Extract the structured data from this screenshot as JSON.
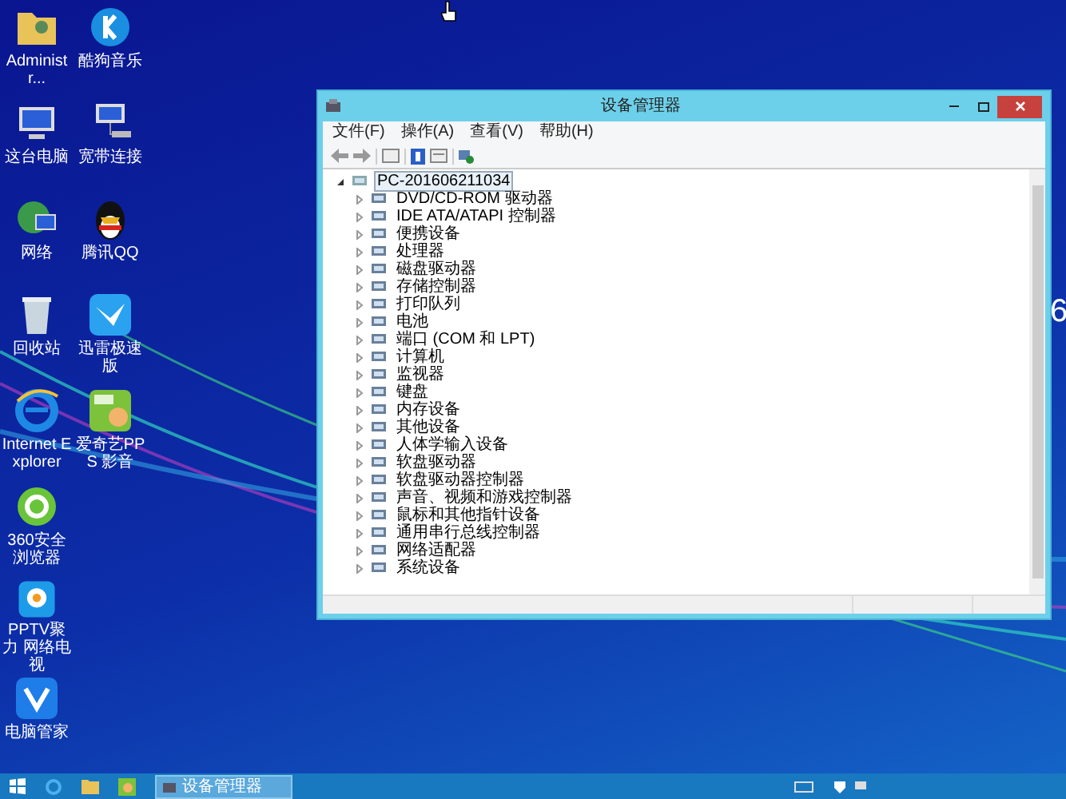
{
  "desktop": {
    "icons": [
      {
        "label": "Administr...",
        "kind": "folder"
      },
      {
        "label": "这台电脑",
        "kind": "computer"
      },
      {
        "label": "网络",
        "kind": "globe"
      },
      {
        "label": "回收站",
        "kind": "trash"
      },
      {
        "label": "Internet Explorer",
        "kind": "ie"
      },
      {
        "label": "360安全浏览器",
        "kind": "green-browser"
      },
      {
        "label": "PPTV聚力 网络电视",
        "kind": "pptv"
      },
      {
        "label": "电脑管家",
        "kind": "shield"
      },
      {
        "label": "酷狗音乐",
        "kind": "k-circle"
      },
      {
        "label": "宽带连接",
        "kind": "network"
      },
      {
        "label": "腾讯QQ",
        "kind": "penguin"
      },
      {
        "label": "迅雷极速版",
        "kind": "bird"
      },
      {
        "label": "爱奇艺PPS 影音",
        "kind": "tv"
      }
    ],
    "edge_text": "6"
  },
  "window": {
    "title": "设备管理器",
    "menu": [
      "文件(F)",
      "操作(A)",
      "查看(V)",
      "帮助(H)"
    ],
    "tree": {
      "label": "PC-201606211034",
      "expanded": true,
      "selected": true,
      "children": [
        {
          "label": "DVD/CD-ROM 驱动器",
          "expanded": false
        },
        {
          "label": "IDE ATA/ATAPI 控制器",
          "expanded": false
        },
        {
          "label": "便携设备",
          "expanded": false
        },
        {
          "label": "处理器",
          "expanded": false
        },
        {
          "label": "磁盘驱动器",
          "expanded": false
        },
        {
          "label": "存储控制器",
          "expanded": false
        },
        {
          "label": "打印队列",
          "expanded": false
        },
        {
          "label": "电池",
          "expanded": false
        },
        {
          "label": "端口 (COM 和 LPT)",
          "expanded": false
        },
        {
          "label": "计算机",
          "expanded": false
        },
        {
          "label": "监视器",
          "expanded": false
        },
        {
          "label": "键盘",
          "expanded": false
        },
        {
          "label": "内存设备",
          "expanded": false
        },
        {
          "label": "其他设备",
          "expanded": false
        },
        {
          "label": "人体学输入设备",
          "expanded": false
        },
        {
          "label": "软盘驱动器",
          "expanded": false
        },
        {
          "label": "软盘驱动器控制器",
          "expanded": false
        },
        {
          "label": "声音、视频和游戏控制器",
          "expanded": false
        },
        {
          "label": "鼠标和其他指针设备",
          "expanded": false
        },
        {
          "label": "通用串行总线控制器",
          "expanded": false
        },
        {
          "label": "网络适配器",
          "expanded": false
        },
        {
          "label": "系统设备",
          "expanded": false
        }
      ]
    }
  },
  "taskbar": {
    "tasks": [
      {
        "label": "设备管理器",
        "selected": true
      }
    ]
  }
}
